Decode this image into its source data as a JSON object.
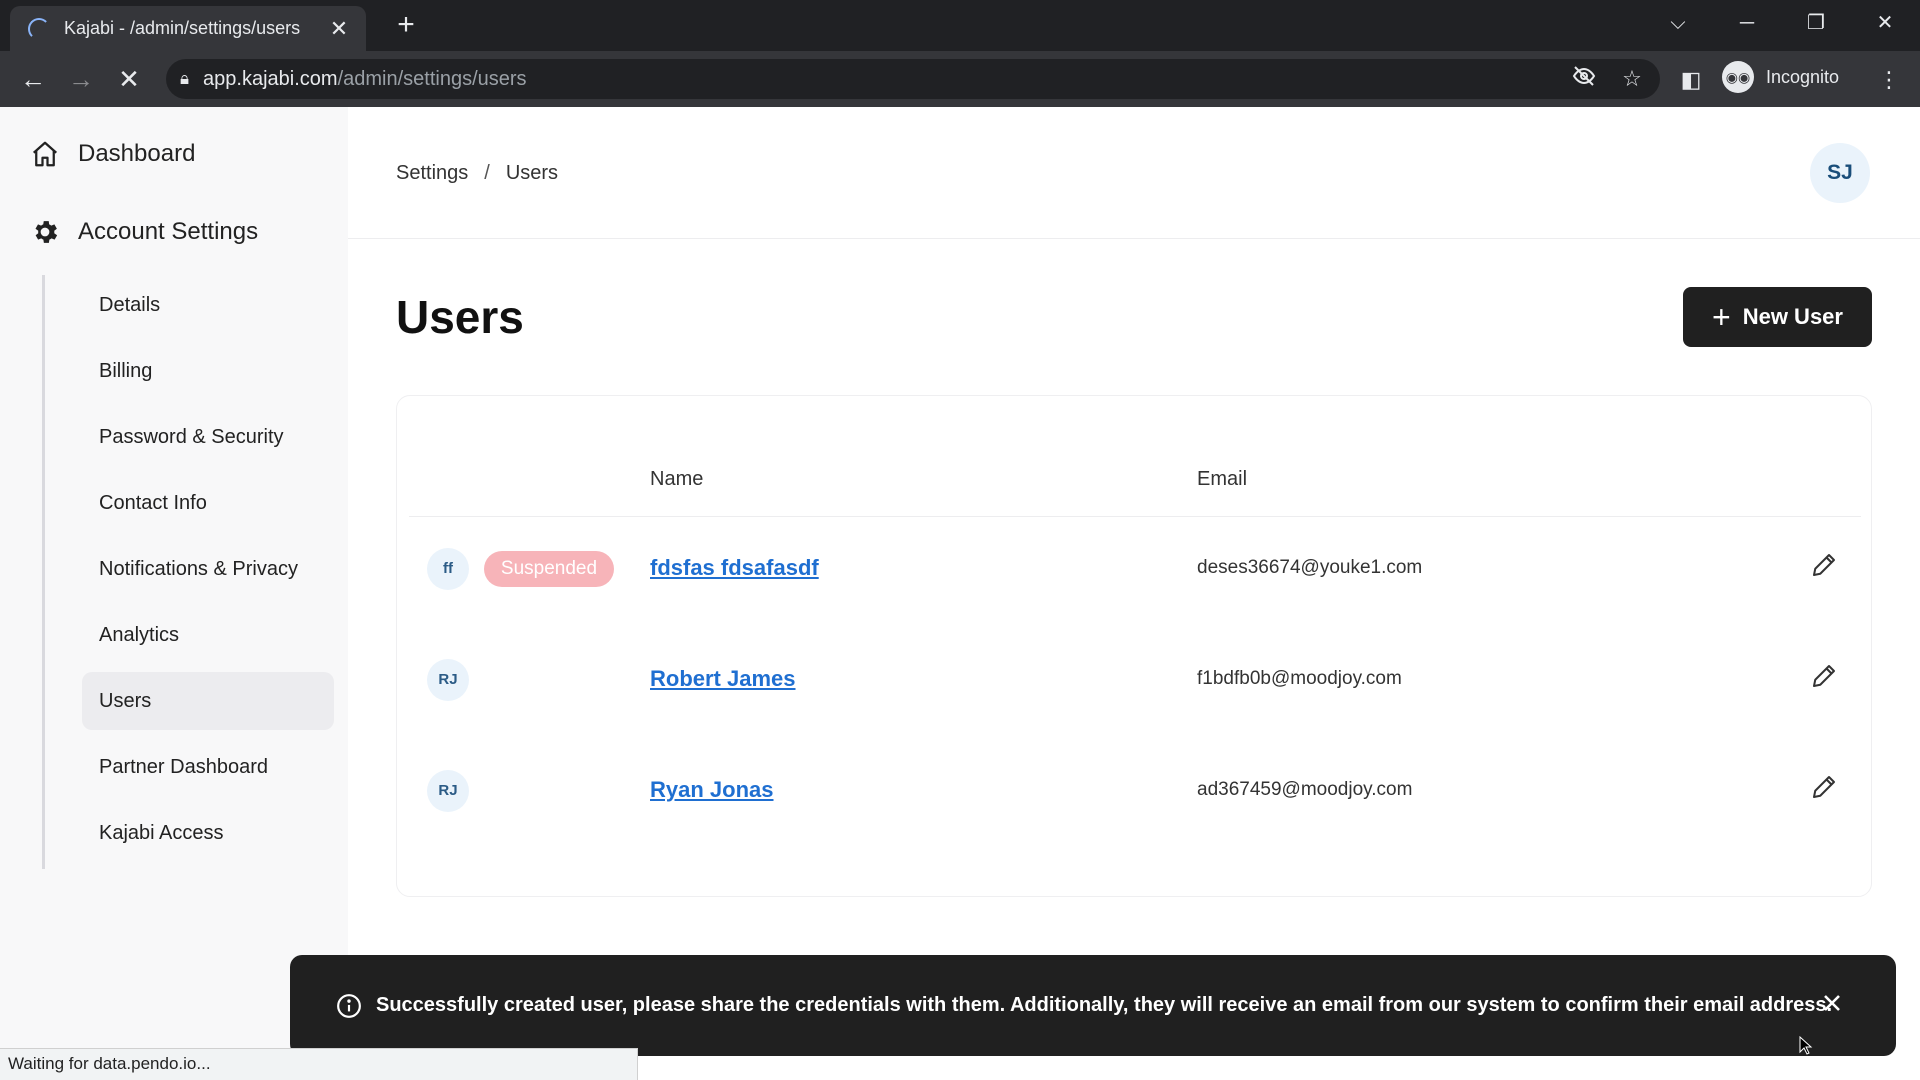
{
  "browser": {
    "tab_title": "Kajabi - /admin/settings/users",
    "tab_close": "✕",
    "new_tab": "+",
    "url_host": "app.kajabi.com",
    "url_path": "/admin/settings/users",
    "incognito_label": "Incognito",
    "status_text": "Waiting for data.pendo.io..."
  },
  "sidebar": {
    "dashboard_label": "Dashboard",
    "account_settings_label": "Account Settings",
    "items": [
      {
        "label": "Details"
      },
      {
        "label": "Billing"
      },
      {
        "label": "Password & Security"
      },
      {
        "label": "Contact Info"
      },
      {
        "label": "Notifications & Privacy"
      },
      {
        "label": "Analytics"
      },
      {
        "label": "Users"
      },
      {
        "label": "Partner Dashboard"
      },
      {
        "label": "Kajabi Access"
      }
    ]
  },
  "header": {
    "breadcrumb_root": "Settings",
    "breadcrumb_sep": "/",
    "breadcrumb_current": "Users",
    "avatar_initials": "SJ"
  },
  "main": {
    "title": "Users",
    "new_user_label": "New User",
    "table": {
      "columns": [
        "Name",
        "Email"
      ],
      "rows": [
        {
          "initials": "ff",
          "badge": "Suspended",
          "name": "fdsfas fdsafasdf",
          "email": "deses36674@youke1.com"
        },
        {
          "initials": "RJ",
          "badge": "",
          "name": "Robert James",
          "email": "f1bdfb0b@moodjoy.com"
        },
        {
          "initials": "RJ",
          "badge": "",
          "name": "Ryan Jonas",
          "email": "ad367459@moodjoy.com"
        }
      ]
    }
  },
  "toast": {
    "message": "Successfully created user, please share the credentials with them. Additionally, they will receive an email from our system to confirm their email address."
  },
  "colors": {
    "accent_link": "#1f6fd1",
    "button_dark": "#202020",
    "suspended_badge": "#f7b4b9",
    "avatar_bg": "#eaf3fb"
  }
}
